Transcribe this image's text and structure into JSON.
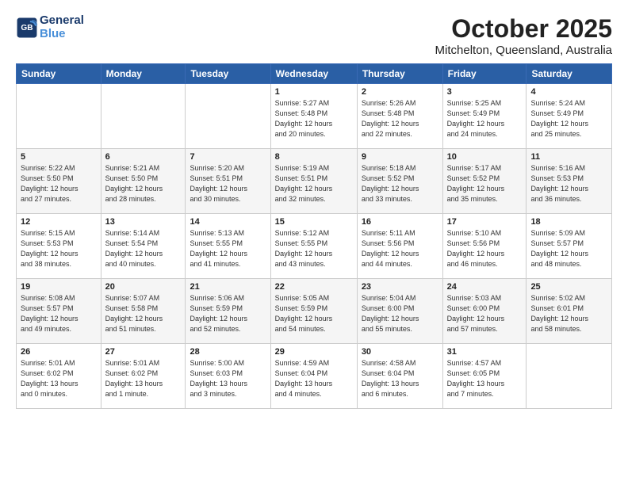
{
  "header": {
    "logo_line1": "General",
    "logo_line2": "Blue",
    "title": "October 2025",
    "subtitle": "Mitchelton, Queensland, Australia"
  },
  "weekdays": [
    "Sunday",
    "Monday",
    "Tuesday",
    "Wednesday",
    "Thursday",
    "Friday",
    "Saturday"
  ],
  "weeks": [
    [
      {
        "day": "",
        "info": ""
      },
      {
        "day": "",
        "info": ""
      },
      {
        "day": "",
        "info": ""
      },
      {
        "day": "1",
        "info": "Sunrise: 5:27 AM\nSunset: 5:48 PM\nDaylight: 12 hours\nand 20 minutes."
      },
      {
        "day": "2",
        "info": "Sunrise: 5:26 AM\nSunset: 5:48 PM\nDaylight: 12 hours\nand 22 minutes."
      },
      {
        "day": "3",
        "info": "Sunrise: 5:25 AM\nSunset: 5:49 PM\nDaylight: 12 hours\nand 24 minutes."
      },
      {
        "day": "4",
        "info": "Sunrise: 5:24 AM\nSunset: 5:49 PM\nDaylight: 12 hours\nand 25 minutes."
      }
    ],
    [
      {
        "day": "5",
        "info": "Sunrise: 5:22 AM\nSunset: 5:50 PM\nDaylight: 12 hours\nand 27 minutes."
      },
      {
        "day": "6",
        "info": "Sunrise: 5:21 AM\nSunset: 5:50 PM\nDaylight: 12 hours\nand 28 minutes."
      },
      {
        "day": "7",
        "info": "Sunrise: 5:20 AM\nSunset: 5:51 PM\nDaylight: 12 hours\nand 30 minutes."
      },
      {
        "day": "8",
        "info": "Sunrise: 5:19 AM\nSunset: 5:51 PM\nDaylight: 12 hours\nand 32 minutes."
      },
      {
        "day": "9",
        "info": "Sunrise: 5:18 AM\nSunset: 5:52 PM\nDaylight: 12 hours\nand 33 minutes."
      },
      {
        "day": "10",
        "info": "Sunrise: 5:17 AM\nSunset: 5:52 PM\nDaylight: 12 hours\nand 35 minutes."
      },
      {
        "day": "11",
        "info": "Sunrise: 5:16 AM\nSunset: 5:53 PM\nDaylight: 12 hours\nand 36 minutes."
      }
    ],
    [
      {
        "day": "12",
        "info": "Sunrise: 5:15 AM\nSunset: 5:53 PM\nDaylight: 12 hours\nand 38 minutes."
      },
      {
        "day": "13",
        "info": "Sunrise: 5:14 AM\nSunset: 5:54 PM\nDaylight: 12 hours\nand 40 minutes."
      },
      {
        "day": "14",
        "info": "Sunrise: 5:13 AM\nSunset: 5:55 PM\nDaylight: 12 hours\nand 41 minutes."
      },
      {
        "day": "15",
        "info": "Sunrise: 5:12 AM\nSunset: 5:55 PM\nDaylight: 12 hours\nand 43 minutes."
      },
      {
        "day": "16",
        "info": "Sunrise: 5:11 AM\nSunset: 5:56 PM\nDaylight: 12 hours\nand 44 minutes."
      },
      {
        "day": "17",
        "info": "Sunrise: 5:10 AM\nSunset: 5:56 PM\nDaylight: 12 hours\nand 46 minutes."
      },
      {
        "day": "18",
        "info": "Sunrise: 5:09 AM\nSunset: 5:57 PM\nDaylight: 12 hours\nand 48 minutes."
      }
    ],
    [
      {
        "day": "19",
        "info": "Sunrise: 5:08 AM\nSunset: 5:57 PM\nDaylight: 12 hours\nand 49 minutes."
      },
      {
        "day": "20",
        "info": "Sunrise: 5:07 AM\nSunset: 5:58 PM\nDaylight: 12 hours\nand 51 minutes."
      },
      {
        "day": "21",
        "info": "Sunrise: 5:06 AM\nSunset: 5:59 PM\nDaylight: 12 hours\nand 52 minutes."
      },
      {
        "day": "22",
        "info": "Sunrise: 5:05 AM\nSunset: 5:59 PM\nDaylight: 12 hours\nand 54 minutes."
      },
      {
        "day": "23",
        "info": "Sunrise: 5:04 AM\nSunset: 6:00 PM\nDaylight: 12 hours\nand 55 minutes."
      },
      {
        "day": "24",
        "info": "Sunrise: 5:03 AM\nSunset: 6:00 PM\nDaylight: 12 hours\nand 57 minutes."
      },
      {
        "day": "25",
        "info": "Sunrise: 5:02 AM\nSunset: 6:01 PM\nDaylight: 12 hours\nand 58 minutes."
      }
    ],
    [
      {
        "day": "26",
        "info": "Sunrise: 5:01 AM\nSunset: 6:02 PM\nDaylight: 13 hours\nand 0 minutes."
      },
      {
        "day": "27",
        "info": "Sunrise: 5:01 AM\nSunset: 6:02 PM\nDaylight: 13 hours\nand 1 minute."
      },
      {
        "day": "28",
        "info": "Sunrise: 5:00 AM\nSunset: 6:03 PM\nDaylight: 13 hours\nand 3 minutes."
      },
      {
        "day": "29",
        "info": "Sunrise: 4:59 AM\nSunset: 6:04 PM\nDaylight: 13 hours\nand 4 minutes."
      },
      {
        "day": "30",
        "info": "Sunrise: 4:58 AM\nSunset: 6:04 PM\nDaylight: 13 hours\nand 6 minutes."
      },
      {
        "day": "31",
        "info": "Sunrise: 4:57 AM\nSunset: 6:05 PM\nDaylight: 13 hours\nand 7 minutes."
      },
      {
        "day": "",
        "info": ""
      }
    ]
  ]
}
